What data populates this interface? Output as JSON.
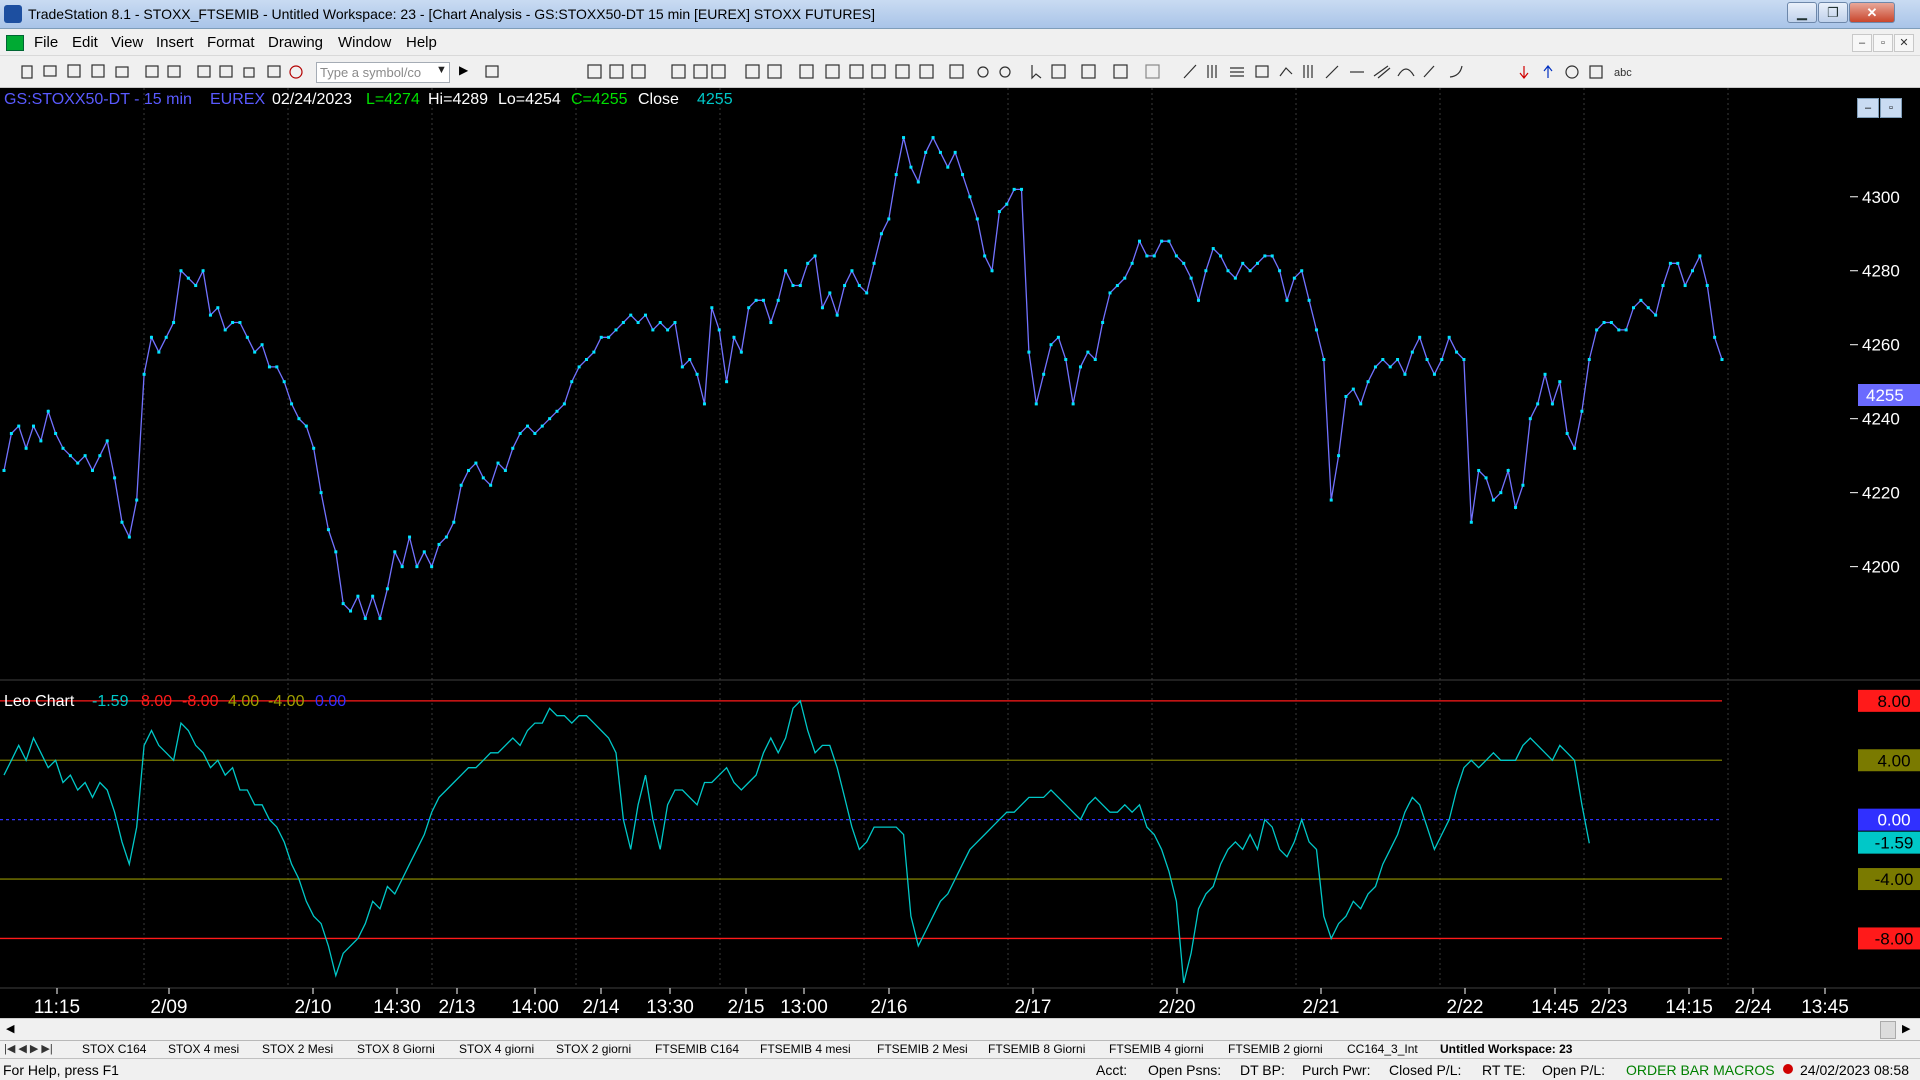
{
  "window": {
    "title": "TradeStation 8.1 - STOXX_FTSEMIB - Untitled Workspace:  23 - [Chart Analysis - GS:STOXX50-DT  15 min  [EUREX] STOXX FUTURES]",
    "minimize": "▁",
    "restore": "❐",
    "close": "✕"
  },
  "menu": {
    "items": [
      "File",
      "Edit",
      "View",
      "Insert",
      "Format",
      "Drawing",
      "Window",
      "Help"
    ],
    "mdi": [
      "–",
      "▫",
      "✕"
    ]
  },
  "toolbar": {
    "symbol_placeholder": "Type a symbol/co"
  },
  "colors": {
    "price": "#7272ff",
    "price_marker": "#00e5ff",
    "osc": "#00c8c8",
    "red": "#ff1a1a",
    "olive": "#7a7a00",
    "blue": "#3030ff",
    "green": "#00e000"
  },
  "chart_header": {
    "symbol": "GS:STOXX50-DT - 15 min",
    "exchange": "EUREX",
    "date": "02/24/2023",
    "last": "L=4274",
    "high": "Hi=4289",
    "low": "Lo=4254",
    "close": "C=4255",
    "close_label": "Close",
    "close_value": "4255"
  },
  "indicator_header": {
    "name": "Leo Chart",
    "v1": "-1.59",
    "v2": "8.00",
    "v3": "-8.00",
    "v4": "4.00",
    "v5": "-4.00",
    "v6": "0.00"
  },
  "price_axis": {
    "ticks": [
      "4300",
      "4280",
      "4260",
      "4240",
      "4220",
      "4200"
    ],
    "last_badge": "4255"
  },
  "osc_axis": {
    "badges": [
      "8.00",
      "4.00",
      "0.00",
      "-1.59",
      "-4.00",
      "-8.00"
    ]
  },
  "time_axis": {
    "labels": [
      "11:15",
      "2/09",
      "2/10",
      "14:30",
      "2/13",
      "14:00",
      "2/14",
      "13:30",
      "2/15",
      "13:00",
      "2/16",
      "2/17",
      "2/20",
      "2/21",
      "2/22",
      "14:45",
      "2/23",
      "14:15",
      "2/24",
      "13:45"
    ]
  },
  "chart_data": [
    {
      "type": "line",
      "title": "GS:STOXX50-DT - 15 min",
      "series": [
        {
          "name": "Close",
          "y": [
            4226,
            4236,
            4238,
            4232,
            4238,
            4234,
            4242,
            4236,
            4232,
            4230,
            4228,
            4230,
            4226,
            4230,
            4234,
            4224,
            4212,
            4208,
            4218,
            4252,
            4262,
            4258,
            4262,
            4266,
            4280,
            4278,
            4276,
            4280,
            4268,
            4270,
            4264,
            4266,
            4266,
            4262,
            4258,
            4260,
            4254,
            4254,
            4250,
            4244,
            4240,
            4238,
            4232,
            4220,
            4210,
            4204,
            4190,
            4188,
            4192,
            4186,
            4192,
            4186,
            4194,
            4204,
            4200,
            4208,
            4200,
            4204,
            4200,
            4206,
            4208,
            4212,
            4222,
            4226,
            4228,
            4224,
            4222,
            4228,
            4226,
            4232,
            4236,
            4238,
            4236,
            4238,
            4240,
            4242,
            4244,
            4250,
            4254,
            4256,
            4258,
            4262,
            4262,
            4264,
            4266,
            4268,
            4266,
            4268,
            4264,
            4266,
            4264,
            4266,
            4254,
            4256,
            4252,
            4244,
            4270,
            4264,
            4250,
            4262,
            4258,
            4270,
            4272,
            4272,
            4266,
            4272,
            4280,
            4276,
            4276,
            4282,
            4284,
            4270,
            4274,
            4268,
            4276,
            4280,
            4276,
            4274,
            4282,
            4290,
            4294,
            4306,
            4316,
            4308,
            4304,
            4312,
            4316,
            4312,
            4308,
            4312,
            4306,
            4300,
            4294,
            4284,
            4280,
            4296,
            4298,
            4302,
            4302,
            4258,
            4244,
            4252,
            4260,
            4262,
            4256,
            4244,
            4254,
            4258,
            4256,
            4266,
            4274,
            4276,
            4278,
            4282,
            4288,
            4284,
            4284,
            4288,
            4288,
            4284,
            4282,
            4278,
            4272,
            4280,
            4286,
            4284,
            4280,
            4278,
            4282,
            4280,
            4282,
            4284,
            4284,
            4280,
            4272,
            4278,
            4280,
            4272,
            4264,
            4256,
            4218,
            4230,
            4246,
            4248,
            4244,
            4250,
            4254,
            4256,
            4254,
            4256,
            4252,
            4258,
            4262,
            4256,
            4252,
            4256,
            4262,
            4258,
            4256,
            4212,
            4226,
            4224,
            4218,
            4220,
            4226,
            4216,
            4222,
            4240,
            4244,
            4252,
            4244,
            4250,
            4236,
            4232,
            4242,
            4256,
            4264,
            4266,
            4266,
            4264,
            4264,
            4270,
            4272,
            4270,
            4268,
            4276,
            4282,
            4282,
            4276,
            4280,
            4284,
            4276,
            4262,
            4256
          ]
        }
      ],
      "yticks": [
        4200,
        4220,
        4240,
        4260,
        4280,
        4300
      ],
      "ylim": [
        4178,
        4324
      ]
    },
    {
      "type": "line",
      "title": "Leo Chart",
      "series": [
        {
          "name": "Leo Chart",
          "y": [
            3.0,
            4.0,
            5.0,
            4.0,
            5.5,
            4.5,
            3.5,
            4.0,
            2.5,
            3.0,
            2.0,
            2.5,
            1.5,
            2.5,
            2.0,
            0.5,
            -1.5,
            -3.0,
            -0.5,
            5.0,
            6.0,
            5.0,
            4.5,
            4.0,
            6.5,
            6.0,
            5.0,
            4.5,
            3.5,
            4.0,
            3.0,
            3.5,
            2.0,
            2.0,
            1.0,
            1.0,
            0.0,
            -0.5,
            -1.5,
            -3.0,
            -4.0,
            -5.5,
            -6.5,
            -7.0,
            -8.5,
            -10.5,
            -9.0,
            -8.5,
            -8.0,
            -7.0,
            -5.5,
            -6.0,
            -4.5,
            -5.0,
            -4.0,
            -3.0,
            -2.0,
            -1.0,
            0.5,
            1.5,
            2.0,
            2.5,
            3.0,
            3.5,
            3.5,
            4.0,
            4.5,
            4.5,
            5.0,
            5.5,
            5.0,
            6.0,
            6.5,
            6.5,
            7.5,
            7.0,
            7.0,
            6.5,
            7.0,
            7.0,
            6.5,
            6.0,
            5.5,
            4.5,
            0.0,
            -2.0,
            1.0,
            3.0,
            0.0,
            -2.0,
            1.0,
            2.0,
            2.0,
            1.5,
            1.0,
            2.5,
            2.5,
            3.0,
            3.5,
            2.5,
            2.0,
            2.5,
            3.0,
            4.5,
            5.5,
            4.5,
            5.5,
            7.5,
            8.0,
            6.0,
            4.5,
            5.0,
            5.0,
            3.5,
            1.5,
            -0.5,
            -2.0,
            -1.5,
            -0.5,
            -0.5,
            -0.5,
            -0.5,
            -1.0,
            -6.5,
            -8.5,
            -7.5,
            -6.5,
            -5.5,
            -5.0,
            -4.0,
            -3.0,
            -2.0,
            -1.5,
            -1.0,
            -0.5,
            0.0,
            0.5,
            0.5,
            1.0,
            1.5,
            1.5,
            1.5,
            2.0,
            1.5,
            1.0,
            0.5,
            0.0,
            1.0,
            1.5,
            1.0,
            0.5,
            0.5,
            1.0,
            0.5,
            1.0,
            -0.5,
            -1.0,
            -2.0,
            -3.5,
            -5.5,
            -11.0,
            -9.0,
            -6.0,
            -5.0,
            -4.5,
            -3.0,
            -2.0,
            -1.5,
            -2.0,
            -1.0,
            -2.0,
            0.0,
            -0.5,
            -2.0,
            -2.5,
            -1.5,
            0.0,
            -1.5,
            -2.0,
            -6.5,
            -8.0,
            -7.0,
            -6.5,
            -5.5,
            -6.0,
            -5.0,
            -4.5,
            -3.0,
            -2.0,
            -1.0,
            0.5,
            1.5,
            1.0,
            -0.5,
            -2.0,
            -1.0,
            0.0,
            2.0,
            3.5,
            4.0,
            3.5,
            4.0,
            4.5,
            4.0,
            4.0,
            4.0,
            5.0,
            5.5,
            5.0,
            4.5,
            4.0,
            5.0,
            4.5,
            4.0,
            1.0,
            -1.59
          ]
        }
      ],
      "reference_lines": [
        8,
        4,
        0,
        -4,
        -8
      ],
      "ylim": [
        -11,
        9
      ]
    }
  ],
  "tabs": [
    "STOX C164",
    "STOX 4 mesi",
    "STOX  2 Mesi",
    "STOX  8 Giorni",
    "STOX 4 giorni",
    "STOX  2 giorni",
    "FTSEMIB C164",
    "FTSEMIB 4 mesi",
    "FTSEMIB  2 Mesi",
    "FTSEMIB  8 Giorni",
    "FTSEMIB  4 giorni",
    "FTSEMIB  2 giorni",
    "CC164_3_Int",
    "Untitled Workspace: 23"
  ],
  "status": {
    "help": "For Help, press F1",
    "acct": "Acct:",
    "open_psns": "Open Psns:",
    "dt_bp": "DT BP:",
    "purch_pwr": "Purch Pwr:",
    "closed_pl": "Closed P/L:",
    "rt_te": "RT TE:",
    "open_pl": "Open P/L:",
    "macros": "ORDER BAR  MACROS",
    "datetime": "24/02/2023 08:58"
  }
}
